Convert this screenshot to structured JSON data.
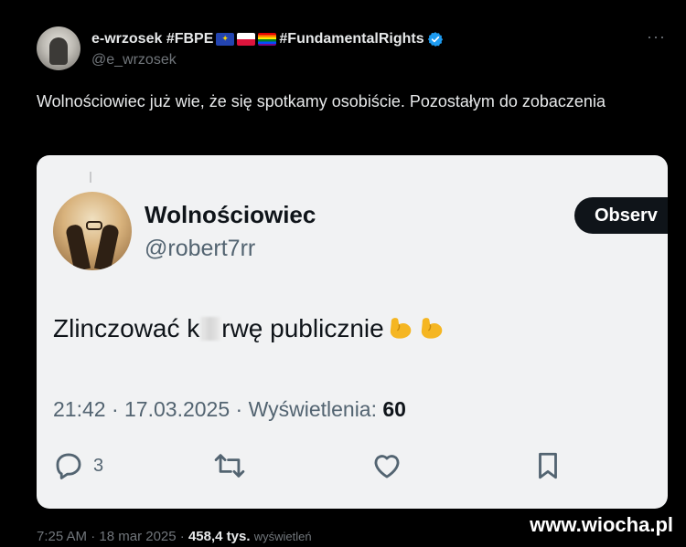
{
  "tweet": {
    "author_name": "e-wrzosek #FBPE",
    "author_hashtag": "#FundamentalRights",
    "handle": "@e_wrzosek",
    "more_label": "···",
    "text": "Wolnościowiec już wie, że się spotkamy osobiście. Pozostałym do zobaczenia",
    "time": "7:25 AM",
    "date": "18 mar 2025",
    "views_count": "458,4 tys.",
    "views_label": "wyświetleń"
  },
  "quoted": {
    "author_name": "Wolnościowiec",
    "handle": "@robert7rr",
    "follow_label": "Observ",
    "text_before": "Zlinczować k",
    "text_after": "rwę publicznie",
    "time": "21:42",
    "date": "17.03.2025",
    "views_label": "Wyświetlenia:",
    "views_count": "60",
    "reply_count": "3"
  },
  "watermark": "www.wiocha.pl",
  "colors": {
    "background": "#000000",
    "card": "#f1f2f3",
    "verified": "#1d9bf0",
    "muted": "#71767b",
    "emoji": "#f5b622"
  },
  "icons": [
    "verified-icon",
    "more-icon",
    "reply-icon",
    "retweet-icon",
    "like-icon",
    "bookmark-icon",
    "flexed-biceps-icon"
  ]
}
